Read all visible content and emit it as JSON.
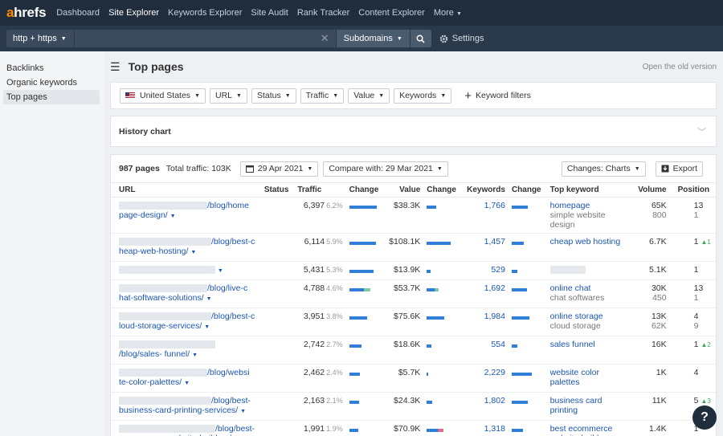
{
  "nav": {
    "logo_a": "a",
    "logo_rest": "hrefs",
    "items": [
      "Dashboard",
      "Site Explorer",
      "Keywords Explorer",
      "Site Audit",
      "Rank Tracker",
      "Content Explorer",
      "More"
    ]
  },
  "search": {
    "protocol": "http + https",
    "mode": "Subdomains",
    "settings": "Settings"
  },
  "sidebar": {
    "items": [
      "Backlinks",
      "Organic keywords",
      "Top pages"
    ]
  },
  "header": {
    "title": "Top pages",
    "old_version": "Open the old version"
  },
  "filters": {
    "country": "United States",
    "url": "URL",
    "status": "Status",
    "traffic": "Traffic",
    "value": "Value",
    "keywords": "Keywords",
    "keyword_filters": "Keyword filters"
  },
  "history": {
    "title": "History chart"
  },
  "toolbar": {
    "pages": "987 pages",
    "total_traffic": "Total traffic: 103K",
    "date": "29 Apr 2021",
    "compare": "Compare with: 29 Mar 2021",
    "changes": "Changes: Charts",
    "export": "Export"
  },
  "table": {
    "headers": [
      "URL",
      "Status",
      "Traffic",
      "Change",
      "Value",
      "Change",
      "Keywords",
      "Change",
      "Top keyword",
      "Volume",
      "Position"
    ],
    "rows": [
      {
        "url1": "/blog/home",
        "url2": "page-design/",
        "traffic": "6,397",
        "tpct": "6.2%",
        "tbar": 34,
        "value": "$38.3K",
        "vbar": 12,
        "keywords": "1,766",
        "kbar": 20,
        "kw": "homepage",
        "kw2": "simple website design",
        "vol": "65K",
        "vol2": "800",
        "pos": "13",
        "pos2": "1",
        "posup": ""
      },
      {
        "url1": "/blog/best-c",
        "url2": "heap-web-hosting/",
        "traffic": "6,114",
        "tpct": "5.9%",
        "tbar": 33,
        "value": "$108.1K",
        "vbar": 30,
        "keywords": "1,457",
        "kbar": 15,
        "kw": "cheap web hosting",
        "kw2": "",
        "vol": "6.7K",
        "vol2": "",
        "pos": "1",
        "pos2": "",
        "posup": "1"
      },
      {
        "url1": "",
        "url2": "",
        "traffic": "5,431",
        "tpct": "5.3%",
        "tbar": 30,
        "value": "$13.9K",
        "vbar": 5,
        "keywords": "529",
        "kbar": 7,
        "kw": "",
        "kw2": "",
        "vol": "5.1K",
        "vol2": "",
        "pos": "1",
        "pos2": "",
        "posup": ""
      },
      {
        "url1": "/blog/live-c",
        "url2": "hat-software-solutions/",
        "traffic": "4,788",
        "tpct": "4.6%",
        "tbar": 26,
        "value": "$53.7K",
        "vbar": 15,
        "keywords": "1,692",
        "kbar": 19,
        "kw": "online chat",
        "kw2": "chat softwares",
        "vol": "30K",
        "vol2": "450",
        "pos": "13",
        "pos2": "1",
        "posup": ""
      },
      {
        "url1": "/blog/best-c",
        "url2": "loud-storage-services/",
        "traffic": "3,951",
        "tpct": "3.8%",
        "tbar": 22,
        "value": "$75.6K",
        "vbar": 22,
        "keywords": "1,984",
        "kbar": 22,
        "kw": "online storage",
        "kw2": "cloud storage",
        "vol": "13K",
        "vol2": "62K",
        "pos": "4",
        "pos2": "9",
        "posup": ""
      },
      {
        "url1": "/blog/sales-",
        "url2": "funnel/",
        "traffic": "2,742",
        "tpct": "2.7%",
        "tbar": 15,
        "value": "$18.6K",
        "vbar": 6,
        "keywords": "554",
        "kbar": 7,
        "kw": "sales funnel",
        "kw2": "",
        "vol": "16K",
        "vol2": "",
        "pos": "1",
        "pos2": "",
        "posup": "2"
      },
      {
        "url1": "/blog/websi",
        "url2": "te-color-palettes/",
        "traffic": "2,462",
        "tpct": "2.4%",
        "tbar": 13,
        "value": "$5.7K",
        "vbar": 2,
        "keywords": "2,229",
        "kbar": 25,
        "kw": "website color palettes",
        "kw2": "",
        "vol": "1K",
        "vol2": "",
        "pos": "4",
        "pos2": "",
        "posup": ""
      },
      {
        "url1": "/blog/best-",
        "url2": "business-card-printing-services/",
        "traffic": "2,163",
        "tpct": "2.1%",
        "tbar": 12,
        "value": "$24.3K",
        "vbar": 7,
        "keywords": "1,802",
        "kbar": 20,
        "kw": "business card printing",
        "kw2": "",
        "vol": "11K",
        "vol2": "",
        "pos": "5",
        "pos2": "",
        "posup": "3"
      },
      {
        "url1": "/blog/best-e",
        "url2": "commerce-website-builders/",
        "traffic": "1,991",
        "tpct": "1.9%",
        "tbar": 11,
        "value": "$70.9K",
        "vbar": 21,
        "keywords": "1,318",
        "kbar": 14,
        "kw": "best ecommerce website builder",
        "kw2": "",
        "vol": "1.4K",
        "vol2": "",
        "pos": "1",
        "pos2": "",
        "posup": ""
      }
    ]
  },
  "help": "?"
}
